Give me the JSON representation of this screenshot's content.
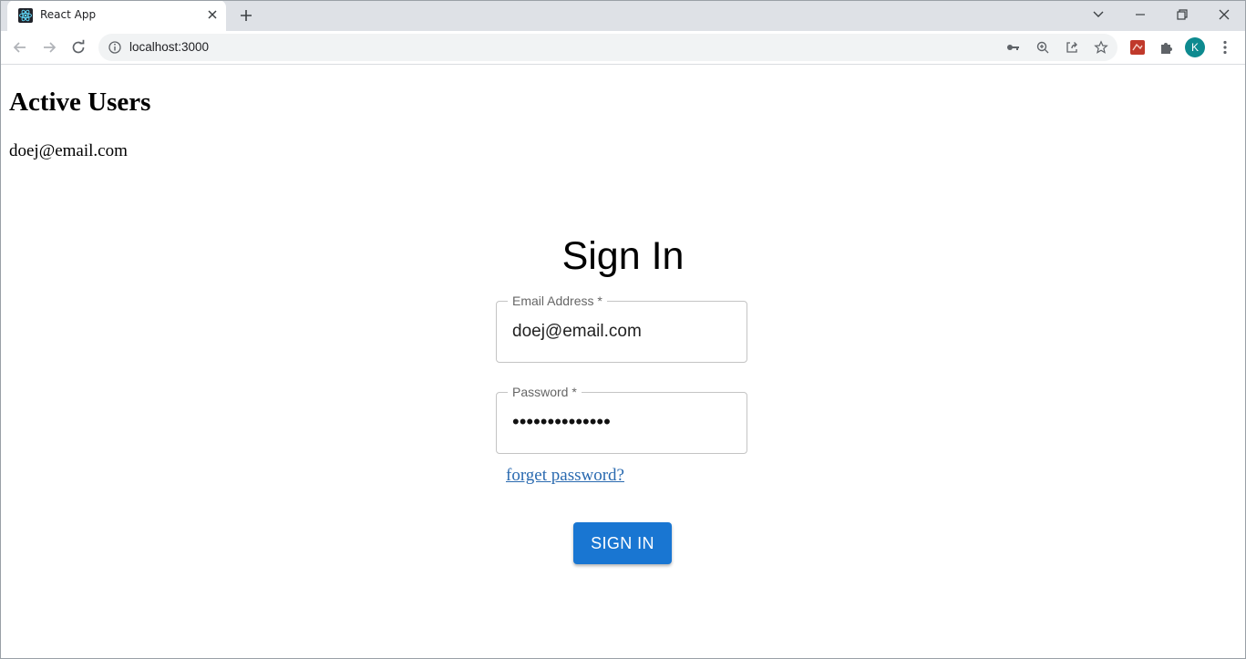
{
  "browser": {
    "tab_title": "React App",
    "url": "localhost:3000",
    "avatar_letter": "K"
  },
  "page": {
    "active_users_heading": "Active Users",
    "active_users": [
      "doej@email.com"
    ],
    "signin_heading": "Sign In",
    "email_label": "Email Address *",
    "email_value": "doej@email.com",
    "password_label": "Password *",
    "password_value": "••••••••••••••",
    "forget_link": "forget password?",
    "signin_button": "SIGN IN"
  },
  "colors": {
    "primary": "#1976d2",
    "link": "#2a6ab0",
    "avatar": "#0d8a8f"
  },
  "icons": {
    "back": "arrow-left-icon",
    "forward": "arrow-right-icon",
    "reload": "reload-icon",
    "info": "info-icon",
    "key": "key-icon",
    "zoom": "zoom-icon",
    "share": "share-icon",
    "bookmark": "star-icon",
    "extension": "puzzle-icon",
    "menu": "kebab-menu-icon"
  }
}
